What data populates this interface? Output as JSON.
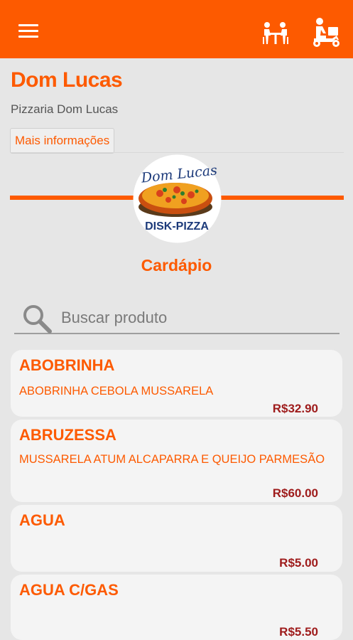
{
  "header": {
    "menu_icon": "hamburger-icon",
    "table_icon": "dining-table-icon",
    "delivery_icon": "delivery-scooter-icon",
    "accent": "#fd5a00"
  },
  "store": {
    "name": "Dom Lucas",
    "subtitle": "Pizzaria Dom Lucas",
    "more_info_label": "Mais informações"
  },
  "logo": {
    "script_text": "Dom Lucas",
    "banner_text": "DISK-PIZZA"
  },
  "menu": {
    "title": "Cardápio",
    "search_placeholder": "Buscar produto",
    "items": [
      {
        "name": "ABOBRINHA",
        "description": "ABOBRINHA CEBOLA MUSSARELA",
        "price": "R$32.90"
      },
      {
        "name": "ABRUZESSA",
        "description": "MUSSARELA ATUM ALCAPARRA E QUEIJO PARMESÃO",
        "price": "R$60.00"
      },
      {
        "name": "AGUA",
        "description": "",
        "price": "R$5.00"
      },
      {
        "name": "AGUA C/GAS",
        "description": "",
        "price": "R$5.50"
      }
    ]
  },
  "colors": {
    "price": "#9e1b1b",
    "card": "#f4f4f4",
    "background": "#e6e6e6"
  }
}
